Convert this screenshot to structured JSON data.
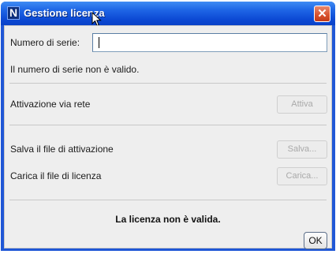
{
  "window": {
    "title": "Gestione licenza",
    "app_icon_glyph": "N",
    "close_glyph": "✕"
  },
  "serial": {
    "label": "Numero di serie:",
    "value": "",
    "error": "Il numero di serie non è valido."
  },
  "network": {
    "label": "Attivazione via rete",
    "button": "Attiva"
  },
  "activation_file": {
    "label": "Salva il file di attivazione",
    "button": "Salva..."
  },
  "license_file": {
    "label": "Carica il file di licenza",
    "button": "Carica..."
  },
  "status": "La licenza non è valida.",
  "ok_label": "OK",
  "colors": {
    "titlebar": "#0c49d4",
    "close": "#d8502c",
    "client_bg": "#eeeeee"
  }
}
